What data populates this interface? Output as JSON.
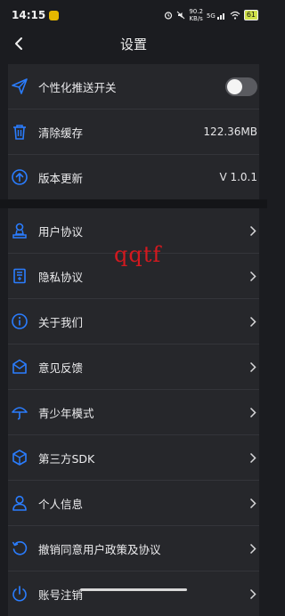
{
  "status": {
    "time": "14:15",
    "net_speed_value": "90.2",
    "net_speed_unit": "KB/s",
    "signal_label": "5G",
    "battery": "61"
  },
  "nav": {
    "title": "设置"
  },
  "settings": {
    "push": {
      "label": "个性化推送开关",
      "enabled": false
    },
    "cache": {
      "label": "清除缓存",
      "value": "122.36MB"
    },
    "update": {
      "label": "版本更新",
      "value": "V 1.0.1"
    },
    "items": [
      {
        "label": "用户协议",
        "icon": "user-agreement-icon"
      },
      {
        "label": "隐私协议",
        "icon": "privacy-icon"
      },
      {
        "label": "关于我们",
        "icon": "info-icon"
      },
      {
        "label": "意见反馈",
        "icon": "feedback-icon"
      },
      {
        "label": "青少年模式",
        "icon": "umbrella-icon"
      },
      {
        "label": "第三方SDK",
        "icon": "cube-icon"
      },
      {
        "label": "个人信息",
        "icon": "person-icon"
      },
      {
        "label": "撤销同意用户政策及协议",
        "icon": "revoke-icon"
      },
      {
        "label": "账号注销",
        "icon": "power-icon"
      }
    ]
  },
  "overlay": {
    "watermark": "qqtf"
  },
  "colors": {
    "accent": "#2a7dff",
    "background": "#1b1c20",
    "card": "#26272b"
  }
}
